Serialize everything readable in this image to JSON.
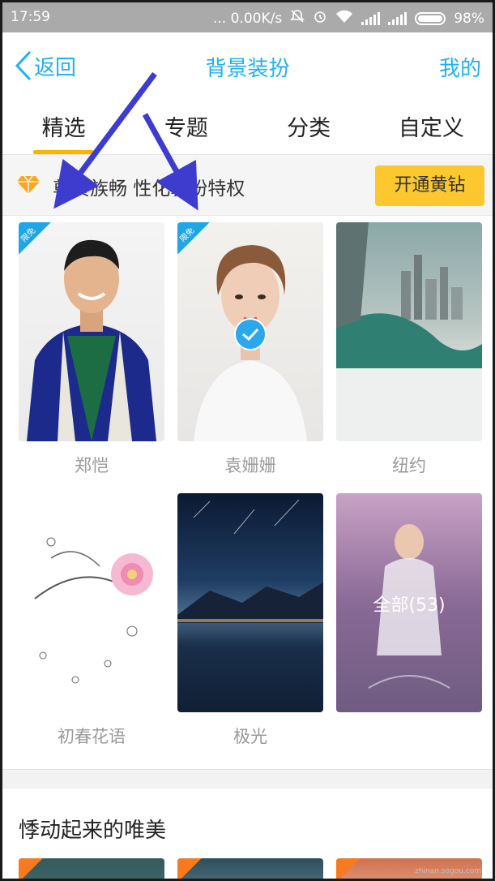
{
  "status_bar": {
    "time": "17:59",
    "network_speed": "... 0.00K/s",
    "battery_percent": "98%"
  },
  "nav": {
    "back_label": "返回",
    "title": "背景装扮",
    "right_link": "我的"
  },
  "tabs": [
    {
      "label": "精选",
      "active": true
    },
    {
      "label": "专题",
      "active": false
    },
    {
      "label": "分类",
      "active": false
    },
    {
      "label": "自定义",
      "active": false
    }
  ],
  "promo": {
    "text": "贵族畅 性化装扮特权",
    "text_prefix": "尊",
    "button_label": "开通黄钻"
  },
  "backgrounds": [
    {
      "name": "郑恺",
      "badge": "限免",
      "selected": false
    },
    {
      "name": "袁姗姗",
      "badge": "限免",
      "selected": true
    },
    {
      "name": "纽约",
      "badge": "",
      "selected": false
    },
    {
      "name": "初春花语",
      "badge": "",
      "selected": false
    },
    {
      "name": "极光",
      "badge": "",
      "selected": false
    },
    {
      "name": "",
      "overlay_label": "全部(53)",
      "badge": "",
      "selected": false
    }
  ],
  "section": {
    "title": "悸动起来的唯美"
  },
  "watermark": "zhinan.sogou.com",
  "colors": {
    "accent": "#1eb2f0",
    "tab_indicator": "#f7b500",
    "vip_button": "#fdc72f",
    "badge": "#1ea6e6",
    "annotation_arrow": "#3d3ccf"
  }
}
